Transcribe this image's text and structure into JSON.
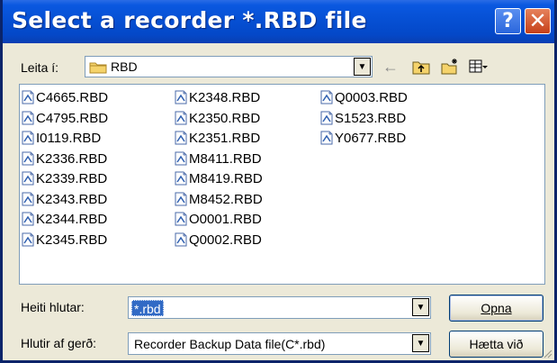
{
  "title": "Select a recorder *.RBD file",
  "title_buttons": {
    "help": "?",
    "close": "✕"
  },
  "look_in": {
    "label": "Leita í:",
    "value": "RBD"
  },
  "toolbar": {
    "back_icon": "back-arrow-icon",
    "up_icon": "up-folder-icon",
    "new_icon": "new-folder-icon",
    "view_icon": "view-menu-icon"
  },
  "files": {
    "col1": [
      "C4665.RBD",
      "C4795.RBD",
      "I0119.RBD",
      "K2336.RBD",
      "K2339.RBD",
      "K2343.RBD",
      "K2344.RBD",
      "K2345.RBD"
    ],
    "col2": [
      "K2348.RBD",
      "K2350.RBD",
      "K2351.RBD",
      "M8411.RBD",
      "M8419.RBD",
      "M8452.RBD",
      "O0001.RBD",
      "Q0002.RBD"
    ],
    "col3": [
      "Q0003.RBD",
      "S1523.RBD",
      "Y0677.RBD"
    ]
  },
  "filename": {
    "label": "Heiti hlutar:",
    "value": "*.rbd"
  },
  "filetype": {
    "label": "Hlutir af gerð:",
    "value": "Recorder Backup Data file(C*.rbd)"
  },
  "buttons": {
    "open": "Opna",
    "cancel": "Hætta við"
  },
  "colors": {
    "titlebar": "#0650d4",
    "selection": "#316ac5",
    "dialog_bg": "#ece9d8"
  }
}
